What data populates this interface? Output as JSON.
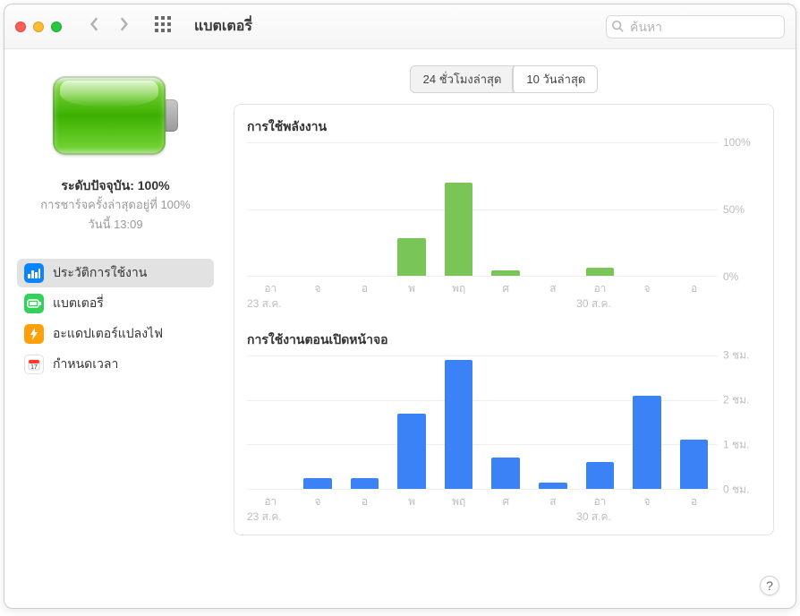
{
  "window": {
    "title": "แบตเตอรี่",
    "search_placeholder": "ค้นหา"
  },
  "sidebar": {
    "status_main": "ระดับปัจจุบัน: 100%",
    "status_sub": "การชาร์จครั้งล่าสุดอยู่ที่ 100%",
    "status_time": "วันนี้ 13:09",
    "items": [
      {
        "icon": "history-icon",
        "label": "ประวัติการใช้งาน",
        "active": true
      },
      {
        "icon": "battery-icon",
        "label": "แบตเตอรี่",
        "active": false
      },
      {
        "icon": "adapter-icon",
        "label": "อะแดปเตอร์แปลงไฟ",
        "active": false
      },
      {
        "icon": "schedule-icon",
        "label": "กำหนดเวลา",
        "active": false
      }
    ]
  },
  "content": {
    "segments": [
      {
        "label": "24 ชั่วโมงล่าสุด",
        "active": false
      },
      {
        "label": "10 วันล่าสุด",
        "active": true
      }
    ],
    "chart1_title": "การใช้พลังงาน",
    "chart2_title": "การใช้งานตอนเปิดหน้าจอ",
    "help_label": "?"
  },
  "chart_data": [
    {
      "type": "bar",
      "title": "การใช้พลังงาน",
      "xlabel": "",
      "ylabel": "",
      "ylim": [
        0,
        100
      ],
      "y_ticks": [
        "100%",
        "50%",
        "0%"
      ],
      "categories": [
        "อา",
        "จ",
        "อ",
        "พ",
        "พฤ",
        "ศ",
        "ส",
        "อา",
        "จ",
        "อ"
      ],
      "secondary_labels": {
        "0": "23 ส.ค.",
        "7": "30 ส.ค."
      },
      "values": [
        0,
        0,
        0,
        28,
        70,
        4,
        0,
        6,
        0,
        0
      ],
      "color": "#7ac558"
    },
    {
      "type": "bar",
      "title": "การใช้งานตอนเปิดหน้าจอ",
      "xlabel": "",
      "ylabel": "ชม.",
      "ylim": [
        0,
        3
      ],
      "y_ticks": [
        "3 ชม.",
        "2 ชม.",
        "1 ชม.",
        "0 ชม."
      ],
      "categories": [
        "อา",
        "จ",
        "อ",
        "พ",
        "พฤ",
        "ศ",
        "ส",
        "อา",
        "จ",
        "อ"
      ],
      "secondary_labels": {
        "0": "23 ส.ค.",
        "7": "30 ส.ค."
      },
      "values": [
        0,
        0.25,
        0.25,
        1.7,
        2.9,
        0.7,
        0.15,
        0.6,
        2.1,
        1.1
      ],
      "color": "#3b82f6"
    }
  ]
}
